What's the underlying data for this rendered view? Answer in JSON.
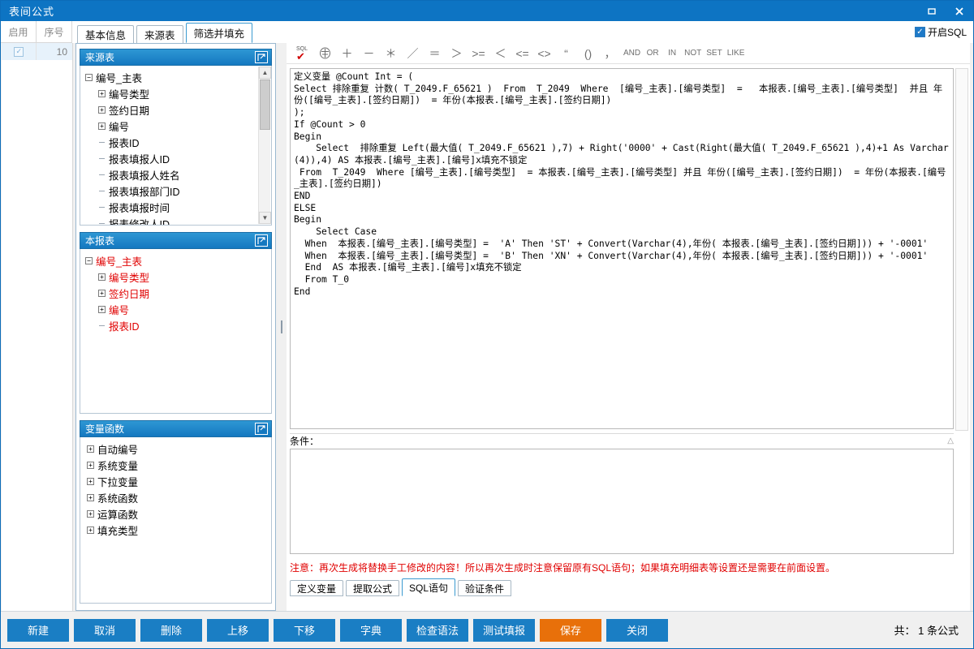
{
  "window": {
    "title": "表间公式",
    "restore_icon": "restore-icon",
    "close_icon": "close-icon"
  },
  "grid": {
    "columns": [
      "启用",
      "序号"
    ],
    "rows": [
      {
        "enabled": true,
        "seq": "10"
      }
    ]
  },
  "tabs": [
    {
      "label": "基本信息",
      "active": false
    },
    {
      "label": "来源表",
      "active": false
    },
    {
      "label": "筛选并填充",
      "active": true
    }
  ],
  "enable_sql": {
    "label": "开启SQL",
    "checked": true,
    "check_glyph": "✓"
  },
  "panels": {
    "source_table": {
      "title": "来源表",
      "popout_icon": "popout-icon",
      "tree": [
        {
          "indent": 0,
          "toggle": "minus",
          "label": "编号_主表",
          "red": false
        },
        {
          "indent": 1,
          "toggle": "plus",
          "label": "编号类型",
          "red": false
        },
        {
          "indent": 1,
          "toggle": "plus",
          "label": "签约日期",
          "red": false
        },
        {
          "indent": 1,
          "toggle": "plus",
          "label": "编号",
          "red": false
        },
        {
          "indent": 1,
          "toggle": "leaf",
          "label": "报表ID",
          "red": false
        },
        {
          "indent": 1,
          "toggle": "leaf",
          "label": "报表填报人ID",
          "red": false
        },
        {
          "indent": 1,
          "toggle": "leaf",
          "label": "报表填报人姓名",
          "red": false
        },
        {
          "indent": 1,
          "toggle": "leaf",
          "label": "报表填报部门ID",
          "red": false
        },
        {
          "indent": 1,
          "toggle": "leaf",
          "label": "报表填报时间",
          "red": false
        },
        {
          "indent": 1,
          "toggle": "leaf",
          "label": "报表修改人ID",
          "red": false
        }
      ]
    },
    "this_report": {
      "title": "本报表",
      "popout_icon": "popout-icon",
      "tree": [
        {
          "indent": 0,
          "toggle": "minus",
          "label": "编号_主表",
          "red": true
        },
        {
          "indent": 1,
          "toggle": "plus",
          "label": "编号类型",
          "red": true
        },
        {
          "indent": 1,
          "toggle": "plus",
          "label": "签约日期",
          "red": true
        },
        {
          "indent": 1,
          "toggle": "plus",
          "label": "编号",
          "red": true
        },
        {
          "indent": 1,
          "toggle": "leaf",
          "label": "报表ID",
          "red": true
        }
      ]
    },
    "variable_functions": {
      "title": "变量函数",
      "popout_icon": "popout-icon",
      "tree": [
        {
          "indent": 0,
          "toggle": "plus",
          "label": "自动编号",
          "red": false
        },
        {
          "indent": 0,
          "toggle": "plus",
          "label": "系统变量",
          "red": false
        },
        {
          "indent": 0,
          "toggle": "plus",
          "label": "下拉变量",
          "red": false
        },
        {
          "indent": 0,
          "toggle": "plus",
          "label": "系统函数",
          "red": false
        },
        {
          "indent": 0,
          "toggle": "plus",
          "label": "运算函数",
          "red": false
        },
        {
          "indent": 0,
          "toggle": "plus",
          "label": "填充类型",
          "red": false
        }
      ]
    }
  },
  "sql_toolbar": [
    {
      "name": "check-sql-icon",
      "glyph": "SQL",
      "kind": "sqlicon"
    },
    {
      "name": "function-icon",
      "glyph": "㈜",
      "kind": "glyph"
    },
    {
      "name": "plus-operator",
      "glyph": "＋",
      "kind": "glyph"
    },
    {
      "name": "minus-operator",
      "glyph": "－",
      "kind": "glyph"
    },
    {
      "name": "multiply-operator",
      "glyph": "＊",
      "kind": "glyph"
    },
    {
      "name": "divide-operator",
      "glyph": "／",
      "kind": "glyph"
    },
    {
      "name": "equals-operator",
      "glyph": "＝",
      "kind": "glyph"
    },
    {
      "name": "greater-than-operator",
      "glyph": "＞",
      "kind": "glyph"
    },
    {
      "name": "greater-equal-operator",
      "glyph": ">=",
      "kind": "glyph"
    },
    {
      "name": "less-than-operator",
      "glyph": "＜",
      "kind": "glyph"
    },
    {
      "name": "less-equal-operator",
      "glyph": "<=",
      "kind": "glyph"
    },
    {
      "name": "not-equal-operator",
      "glyph": "<>",
      "kind": "glyph"
    },
    {
      "name": "quote-operator",
      "glyph": "“",
      "kind": "glyph"
    },
    {
      "name": "parenthesis-operator",
      "glyph": "()",
      "kind": "glyph"
    },
    {
      "name": "comma-operator",
      "glyph": "，",
      "kind": "glyph"
    },
    {
      "name": "and-keyword",
      "glyph": "AND",
      "kind": "word"
    },
    {
      "name": "or-keyword",
      "glyph": "OR",
      "kind": "word"
    },
    {
      "name": "in-keyword",
      "glyph": "IN",
      "kind": "word"
    },
    {
      "name": "not-keyword",
      "glyph": "NOT",
      "kind": "word"
    },
    {
      "name": "set-keyword",
      "glyph": "SET",
      "kind": "word"
    },
    {
      "name": "like-keyword",
      "glyph": "LIKE",
      "kind": "word"
    }
  ],
  "editor": {
    "code": "定义变量 @Count Int = (\nSelect 排除重复 计数( T_2049.F_65621 )  From  T_2049  Where  [编号_主表].[编号类型]  =   本报表.[编号_主表].[编号类型]  并且 年份([编号_主表].[签约日期])  = 年份(本报表.[编号_主表].[签约日期])\n);\nIf @Count > 0\nBegin\n    Select  排除重复 Left(最大值( T_2049.F_65621 ),7) + Right('0000' + Cast(Right(最大值( T_2049.F_65621 ),4)+1 As Varchar(4)),4) AS 本报表.[编号_主表].[编号]x填充不锁定\n From  T_2049  Where [编号_主表].[编号类型]  = 本报表.[编号_主表].[编号类型] 并且 年份([编号_主表].[签约日期])  = 年份(本报表.[编号_主表].[签约日期])\nEND\nELSE\nBegin\n    Select Case\n  When  本报表.[编号_主表].[编号类型] =  'A' Then 'ST' + Convert(Varchar(4),年份( 本报表.[编号_主表].[签约日期])) + '-0001'\n  When  本报表.[编号_主表].[编号类型] =  'B' Then 'XN' + Convert(Varchar(4),年份( 本报表.[编号_主表].[签约日期])) + '-0001'\n  End  AS 本报表.[编号_主表].[编号]x填充不锁定\n  From T_0\nEnd"
  },
  "condition": {
    "label": "条件：",
    "collapse_icon": "collapse-icon",
    "value": ""
  },
  "notice": {
    "text": "注意：再次生成将替换手工修改的内容！所以再次生成时注意保留原有SQL语句；如果填充明细表等设置还是需要在前面设置。",
    "color": "#e00000"
  },
  "bottom_tabs": [
    {
      "label": "定义变量",
      "active": false
    },
    {
      "label": "提取公式",
      "active": false
    },
    {
      "label": "SQL语句",
      "active": true
    },
    {
      "label": "验证条件",
      "active": false
    }
  ],
  "footer": {
    "buttons": [
      {
        "label": "新建",
        "style": "blue"
      },
      {
        "label": "取消",
        "style": "blue"
      },
      {
        "label": "删除",
        "style": "blue"
      },
      {
        "label": "上移",
        "style": "blue"
      },
      {
        "label": "下移",
        "style": "blue"
      },
      {
        "label": "字典",
        "style": "blue"
      },
      {
        "label": "检查语法",
        "style": "blue"
      },
      {
        "label": "测试填报",
        "style": "blue"
      },
      {
        "label": "保存",
        "style": "orange"
      },
      {
        "label": "关闭",
        "style": "blue"
      }
    ],
    "count_text": "共： 1 条公式"
  },
  "colors": {
    "title_bar": "#0d74c3",
    "panel_header": "#1478c0",
    "accent_button": "#1a7ec4",
    "save_button": "#e8700a",
    "notice_red": "#e00000",
    "tree_red": "#e00000"
  }
}
